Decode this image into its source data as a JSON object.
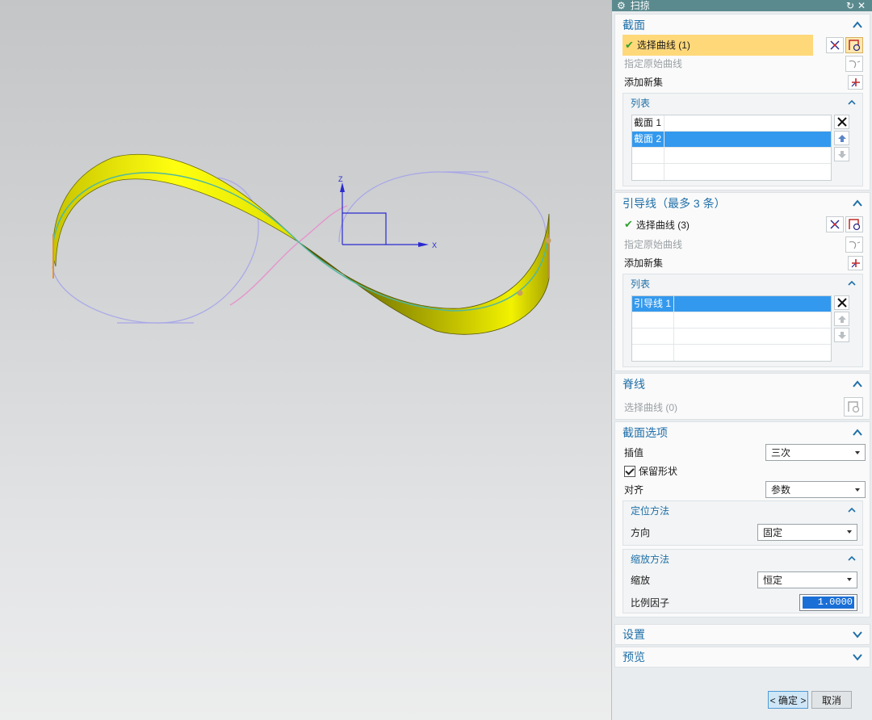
{
  "dialog": {
    "title": "扫掠",
    "section": {
      "title": "截面",
      "select_curve": "选择曲线 (1)",
      "specify_original": "指定原始曲线",
      "add_new_set": "添加新集",
      "list_title": "列表",
      "items": [
        "截面 1",
        "截面 2"
      ],
      "selected_index": 1
    },
    "guide": {
      "title": "引导线（最多 3 条）",
      "select_curve": "选择曲线 (3)",
      "specify_original": "指定原始曲线",
      "add_new_set": "添加新集",
      "list_title": "列表",
      "items": [
        "引导线 1"
      ]
    },
    "spine": {
      "title": "脊线",
      "select_curve": "选择曲线 (0)"
    },
    "section_options": {
      "title": "截面选项",
      "interp_label": "插值",
      "interp_value": "三次",
      "keep_shape_label": "保留形状",
      "keep_shape_checked": true,
      "align_label": "对齐",
      "align_value": "参数",
      "orient": {
        "title": "定位方法",
        "direction_label": "方向",
        "direction_value": "固定"
      },
      "scale": {
        "title": "缩放方法",
        "scale_label": "缩放",
        "scale_value": "恒定",
        "factor_label": "比例因子",
        "factor_value": "1.0000"
      }
    },
    "settings_title": "设置",
    "preview_title": "预览",
    "ok_label": "< 确定 >",
    "cancel_label": "取消"
  },
  "viewport": {
    "axis_x": "X",
    "axis_z": "Z",
    "surface_color": "#f0f000",
    "accent_color": "#1e6fa8"
  }
}
